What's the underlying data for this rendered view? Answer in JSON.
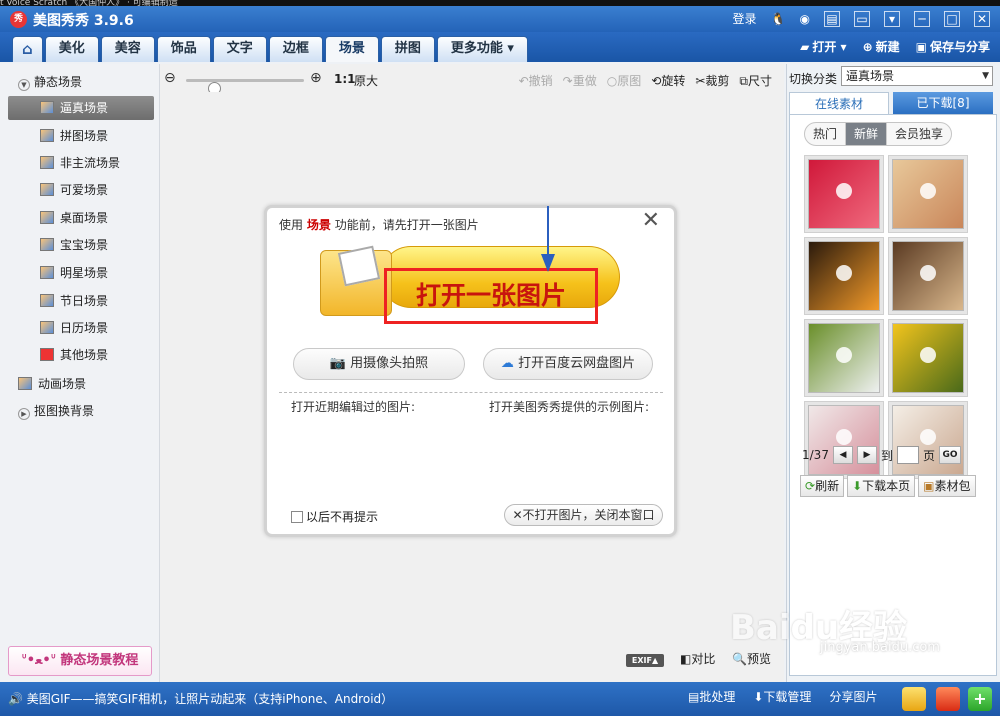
{
  "top_strip": "t     Voice      Scratch     《大国仲人》   · 可编辑制造",
  "app": {
    "logo": "秀",
    "title": "美图秀秀 3.9.6"
  },
  "titlebar": {
    "login": "登录"
  },
  "tabs": [
    "美化",
    "美容",
    "饰品",
    "文字",
    "边框",
    "场景",
    "拼图",
    "更多功能 ▾"
  ],
  "tab_active": "场景",
  "toolbar_right": {
    "open": "打开",
    "new": "新建",
    "save": "保存与分享"
  },
  "sidebar": {
    "static_group": "静态场景",
    "items": [
      "逼真场景",
      "拼图场景",
      "非主流场景",
      "可爱场景",
      "桌面场景",
      "宝宝场景",
      "明星场景",
      "节日场景",
      "日历场景",
      "其他场景"
    ],
    "animated_group": "动画场景",
    "cutout_group": "抠图换背景",
    "tutorial": "静态场景教程"
  },
  "toolbar": {
    "ratio": "1:1",
    "original_size": "原大",
    "undo": "撤销",
    "redo": "重做",
    "original": "原图",
    "rotate": "旋转",
    "crop": "裁剪",
    "size": "尺寸"
  },
  "dialog": {
    "hint_prefix": "使用",
    "hint_keyword": "场景",
    "hint_suffix": "功能前，请先打开一张图片",
    "open_image": "打开一张图片",
    "camera": "用摄像头拍照",
    "baidu": "打开百度云网盘图片",
    "recent": "打开近期编辑过的图片:",
    "samples": "打开美图秀秀提供的示例图片:",
    "no_remind": "以后不再提示",
    "close_btn": "不打开图片，关闭本窗口"
  },
  "bottom_tools": {
    "exif": "EXIF▲",
    "compare": "对比",
    "preview": "预览"
  },
  "right_panel": {
    "category_label": "切换分类",
    "category_value": "逼真场景",
    "tab_online": "在线素材",
    "tab_downloaded": "已下载[8]",
    "filters": [
      "热门",
      "新鲜",
      "会员独享"
    ],
    "filter_active": "新鲜",
    "page": "1/37",
    "goto": "到",
    "page_unit": "页",
    "go": "GO",
    "refresh": "刷新",
    "download_page": "下载本页",
    "material_pack": "素材包"
  },
  "thumbnails": [
    {
      "colors": [
        "#d0183a",
        "#f06a7e"
      ]
    },
    {
      "colors": [
        "#e8c89a",
        "#c9865a"
      ]
    },
    {
      "colors": [
        "#2b1a0c",
        "#f29a2a"
      ]
    },
    {
      "colors": [
        "#5a3a22",
        "#d9b78c"
      ]
    },
    {
      "colors": [
        "#6a8f2a",
        "#eef0f0"
      ]
    },
    {
      "colors": [
        "#f2c41c",
        "#4a6a1a"
      ]
    },
    {
      "colors": [
        "#f0e8e8",
        "#d6909c"
      ]
    },
    {
      "colors": [
        "#f4eee6",
        "#caa890"
      ]
    }
  ],
  "statusbar": {
    "text": "美图GIF——搞笑GIF相机，让照片动起来（支持iPhone、Android）",
    "batch": "批处理",
    "download_mgr": "下载管理",
    "share": "分享图片"
  },
  "watermark": "Baidu经验",
  "watermark_url": "jingyan.baidu.com"
}
